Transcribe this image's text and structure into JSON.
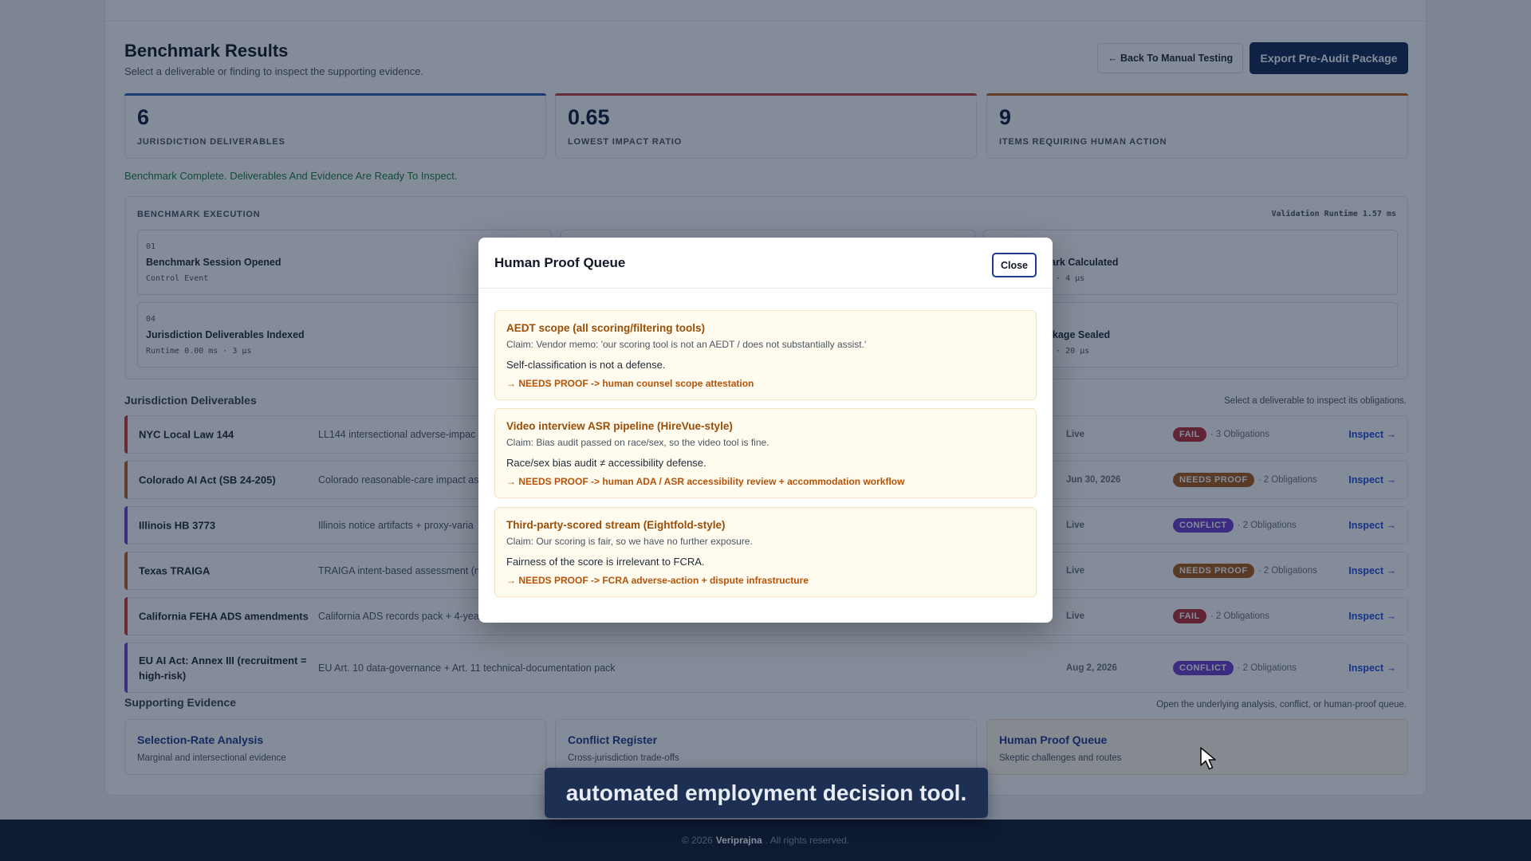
{
  "header": {
    "title": "Benchmark Results",
    "subtitle": "Select a deliverable or finding to inspect the supporting evidence.",
    "back_label": "← Back To Manual Testing",
    "export_label": "Export Pre-Audit Package"
  },
  "stats": [
    {
      "value": "6",
      "label": "JURISDICTION DELIVERABLES",
      "color": "#2f5fb0"
    },
    {
      "value": "0.65",
      "label": "LOWEST IMPACT RATIO",
      "color": "#c23a3a"
    },
    {
      "value": "9",
      "label": "ITEMS REQUIRING HUMAN ACTION",
      "color": "#b8631c"
    }
  ],
  "status_message": "Benchmark Complete. Deliverables And Evidence Are Ready To Inspect.",
  "execution": {
    "title": "BENCHMARK EXECUTION",
    "runtime": "Validation Runtime 1.57 ms",
    "steps": [
      {
        "num": "01",
        "title": "Benchmark Session Opened",
        "meta": "Control Event"
      },
      {
        "num": "",
        "title": "mark Calculated",
        "meta": "ms · 4 µs"
      },
      {
        "num": "04",
        "title": "Jurisdiction Deliverables Indexed",
        "meta": "Runtime 0.00 ms · 3 µs"
      },
      {
        "num": "",
        "title": "ackage Sealed",
        "meta": "ms · 20 µs"
      }
    ]
  },
  "deliverables": {
    "title": "Jurisdiction Deliverables",
    "hint": "Select a deliverable to inspect its obligations.",
    "inspect_label": "Inspect →",
    "rows": [
      {
        "name": "NYC Local Law 144",
        "desc": "LL144 intersectional adverse-impac",
        "date": "Live",
        "badge": "FAIL",
        "obligations": "· 3 Obligations",
        "accent": "#c23a3a",
        "badge_color": "#b42e36"
      },
      {
        "name": "Colorado AI Act (SB 24-205)",
        "desc": "Colorado reasonable-care impact as",
        "date": "Jun 30, 2026",
        "badge": "NEEDS PROOF",
        "obligations": "· 2 Obligations",
        "accent": "#b8631c",
        "badge_color": "#a75a16"
      },
      {
        "name": "Illinois HB 3773",
        "desc": "Illinois notice artifacts + proxy-varia",
        "date": "Live",
        "badge": "CONFLICT",
        "obligations": "· 2 Obligations",
        "accent": "#6d3fd4",
        "badge_color": "#6a3fd0"
      },
      {
        "name": "Texas TRAIGA",
        "desc": "TRAIGA intent-based assessment (n",
        "date": "Live",
        "badge": "NEEDS PROOF",
        "obligations": "· 2 Obligations",
        "accent": "#b8631c",
        "badge_color": "#a75a16"
      },
      {
        "name": "California FEHA ADS amendments",
        "desc": "California ADS records pack + 4-yea",
        "date": "Live",
        "badge": "FAIL",
        "obligations": "· 2 Obligations",
        "accent": "#c23a3a",
        "badge_color": "#b42e36"
      },
      {
        "name": "EU AI Act: Annex III (recruitment = high-risk)",
        "desc": "EU Art. 10 data-governance + Art. 11 technical-documentation pack",
        "date": "Aug 2, 2026",
        "badge": "CONFLICT",
        "obligations": "· 2 Obligations",
        "accent": "#6d3fd4",
        "badge_color": "#6a3fd0"
      }
    ]
  },
  "evidence": {
    "title": "Supporting Evidence",
    "hint": "Open the underlying analysis, conflict, or human-proof queue.",
    "cards": [
      {
        "title": "Selection-Rate Analysis",
        "sub": "Marginal and intersectional evidence"
      },
      {
        "title": "Conflict Register",
        "sub": "Cross-jurisdiction trade-offs"
      },
      {
        "title": "Human Proof Queue",
        "sub": "Skeptic challenges and routes"
      }
    ]
  },
  "footer": {
    "prefix": "© 2026",
    "brand": "Veriprajna",
    "suffix": ". All rights reserved."
  },
  "modal": {
    "title": "Human Proof Queue",
    "close_label": "Close",
    "items": [
      {
        "title": "AEDT scope (all scoring/filtering tools)",
        "claim": "Claim: Vendor memo: 'our scoring tool is not an AEDT / does not substantially assist.'",
        "rebuttal": "Self-classification is not a defense.",
        "route": "→ NEEDS PROOF -> human counsel scope attestation"
      },
      {
        "title": "Video interview ASR pipeline (HireVue-style)",
        "claim": "Claim: Bias audit passed on race/sex, so the video tool is fine.",
        "rebuttal": "Race/sex bias audit ≠ accessibility defense.",
        "route": "→ NEEDS PROOF -> human ADA / ASR accessibility review + accommodation workflow"
      },
      {
        "title": "Third-party-scored stream (Eightfold-style)",
        "claim": "Claim: Our scoring is fair, so we have no further exposure.",
        "rebuttal": "Fairness of the score is irrelevant to FCRA.",
        "route": "→ NEEDS PROOF -> FCRA adverse-action + dispute infrastructure"
      }
    ]
  },
  "toast": "automated employment decision tool."
}
